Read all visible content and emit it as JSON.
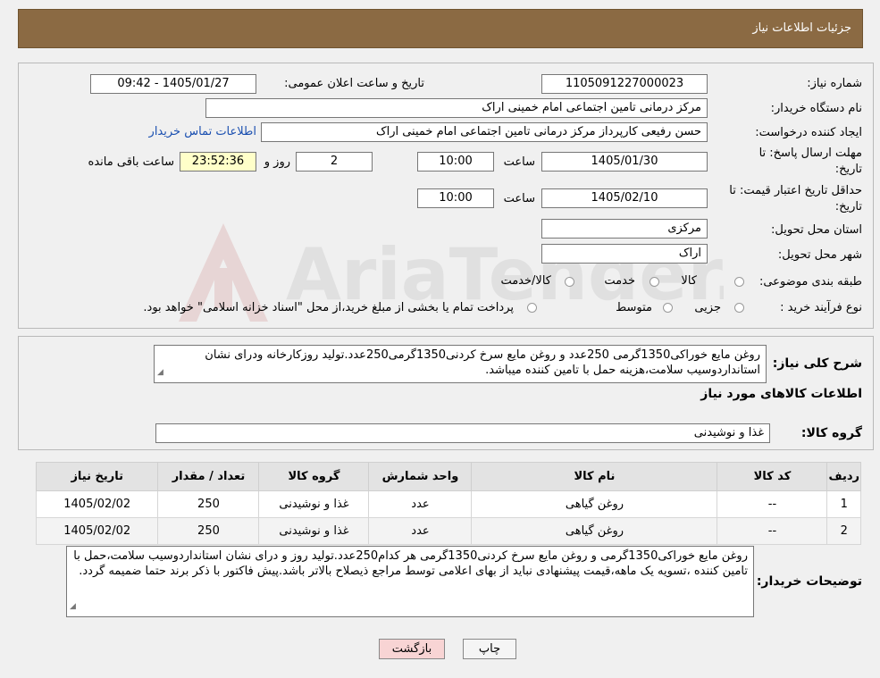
{
  "header": {
    "title": "جزئیات اطلاعات نیاز"
  },
  "form": {
    "need_number_label": "شماره نیاز:",
    "need_number": "1105091227000023",
    "announce_label": "تاریخ و ساعت اعلان عمومی:",
    "announce_value": "1405/01/27 - 09:42",
    "buyer_org_label": "نام دستگاه خریدار:",
    "buyer_org": "مرکز درمانی تامین اجتماعی امام خمینی اراک",
    "creator_label": "ایجاد کننده درخواست:",
    "creator": "حسن رفیعی کارپرداز مرکز درمانی تامین اجتماعی امام خمینی اراک",
    "contact_link": "اطلاعات تماس خریدار",
    "deadline_label_1": "مهلت ارسال پاسخ: تا",
    "deadline_label_2": "تاریخ:",
    "deadline_date": "1405/01/30",
    "time_label": "ساعت",
    "deadline_time": "10:00",
    "days_value": "2",
    "days_label": "روز و",
    "remaining_time": "23:52:36",
    "remaining_label": "ساعت باقی مانده",
    "validity_label_1": "حداقل تاریخ اعتبار قیمت: تا",
    "validity_label_2": "تاریخ:",
    "validity_date": "1405/02/10",
    "validity_time": "10:00",
    "province_label": "استان محل تحویل:",
    "province": "مرکزی",
    "city_label": "شهر محل تحویل:",
    "city": "اراک",
    "category_label": "طبقه بندی موضوعی:",
    "category_options": [
      "کالا",
      "خدمت",
      "کالا/خدمت"
    ],
    "process_label": "نوع فرآیند خرید :",
    "process_options": [
      "جزیی",
      "متوسط"
    ],
    "process_note": "پرداخت تمام یا بخشی از مبلغ خرید،از محل \"اسناد خزانه اسلامی\" خواهد بود."
  },
  "description": {
    "label": "شرح کلی نیاز:",
    "text": "روغن مایع خوراکی1350گرمی 250عدد و روغن مایع سرخ کردنی1350گرمی250عدد.تولید روزکارخانه ودرای نشان استانداردوسیب سلامت،هزینه حمل با تامین کننده میباشد."
  },
  "goods_section": {
    "title": "اطلاعات کالاهای مورد نیاز",
    "group_label": "گروه کالا:",
    "group_value": "غذا و نوشیدنی"
  },
  "table": {
    "headers": [
      "ردیف",
      "کد کالا",
      "نام کالا",
      "واحد شمارش",
      "گروه کالا",
      "تعداد / مقدار",
      "تاریخ نیاز"
    ],
    "rows": [
      [
        "1",
        "--",
        "روغن گیاهی",
        "عدد",
        "غذا و نوشیدنی",
        "250",
        "1405/02/02"
      ],
      [
        "2",
        "--",
        "روغن گیاهی",
        "عدد",
        "غذا و نوشیدنی",
        "250",
        "1405/02/02"
      ]
    ]
  },
  "buyer_notes": {
    "label": "توضیحات خریدار:",
    "text": "روغن مایع خوراکی1350گرمی و روغن مایع سرخ کردنی1350گرمی هر کدام250عدد.تولید روز و درای نشان استانداردوسیب سلامت،حمل با تامین کننده ،تسویه یک ماهه،قیمت پیشنهادی نباید از بهای اعلامی توسط مراجع ذیصلاح بالاتر باشد.پیش فاکتور با ذکر برند حتما ضمیمه گردد."
  },
  "buttons": {
    "print": "چاپ",
    "back": "بازگشت"
  },
  "colors": {
    "header_bg": "#8b6a43",
    "link": "#1a4fb0",
    "back_button": "#f8d4d4"
  }
}
